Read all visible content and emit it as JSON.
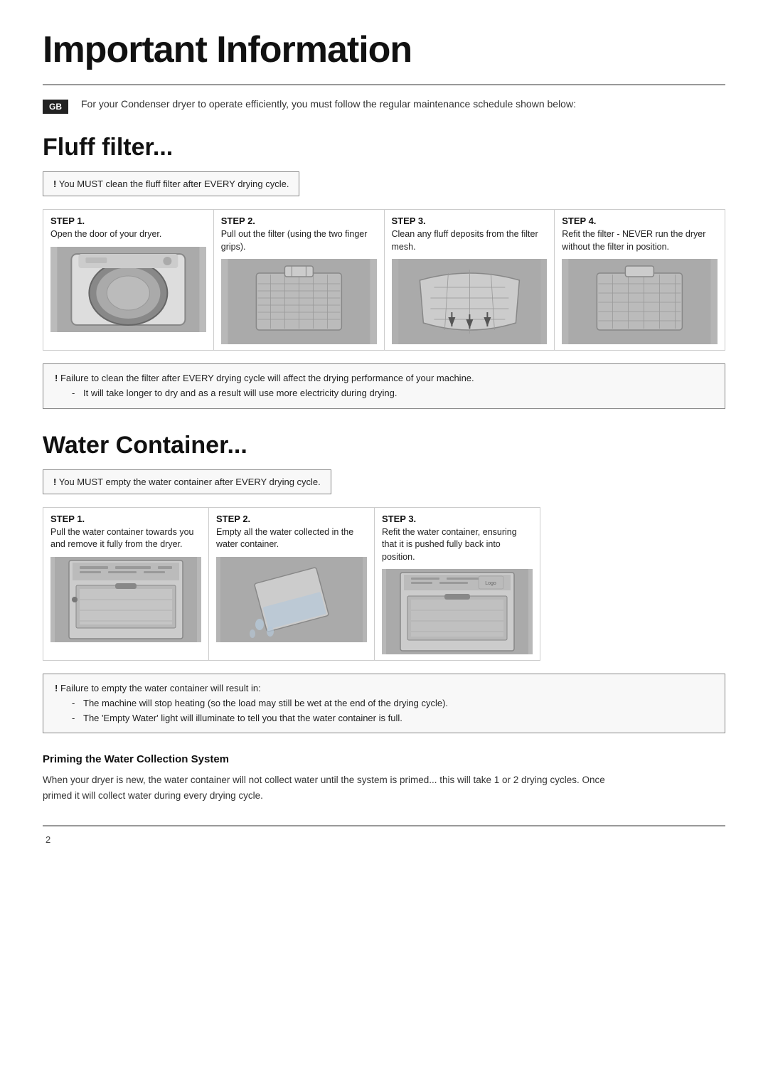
{
  "page": {
    "title": "Important Information",
    "page_number": "2",
    "intro": {
      "gb_label": "GB",
      "text": "For your Condenser dryer to operate efficiently, you must follow the regular maintenance schedule shown below:"
    },
    "fluff_filter": {
      "section_title": "Fluff filter...",
      "notice": {
        "exclaim": "!",
        "text": "You MUST clean the fluff filter after EVERY drying cycle."
      },
      "steps": [
        {
          "label": "STEP 1.",
          "desc": "Open the door of your dryer.",
          "img_alt": "dryer door open"
        },
        {
          "label": "STEP 2.",
          "desc": "Pull out the filter (using the two finger grips).",
          "img_alt": "filter pull"
        },
        {
          "label": "STEP 3.",
          "desc": "Clean any fluff deposits from the filter mesh.",
          "img_alt": "filter clean"
        },
        {
          "label": "STEP 4.",
          "desc": "Refit the filter - NEVER run the dryer without the filter in position.",
          "img_alt": "filter refit"
        }
      ],
      "warning": {
        "exclaim": "!",
        "line1": "Failure to clean the filter after EVERY drying cycle will affect the drying performance of your machine.",
        "list": [
          "It will take longer to dry and as a result will use more electricity during drying."
        ]
      }
    },
    "water_container": {
      "section_title": "Water Container...",
      "notice": {
        "exclaim": "!",
        "text": "You MUST empty the water container after EVERY drying cycle."
      },
      "steps": [
        {
          "label": "STEP 1.",
          "desc": "Pull the water container towards you and remove it fully from the dryer.",
          "img_alt": "water container pull"
        },
        {
          "label": "STEP 2.",
          "desc": "Empty all the water collected in the water container.",
          "img_alt": "water container empty"
        },
        {
          "label": "STEP 3.",
          "desc": "Refit the water container, ensuring that it is pushed fully back into position.",
          "img_alt": "water container refit"
        }
      ],
      "warning": {
        "exclaim": "!",
        "line1": "Failure to empty the water container will result in:",
        "list": [
          "The machine will stop heating (so the load may still be wet at the end of the drying cycle).",
          "The 'Empty Water' light will illuminate to tell you that the water container is full."
        ]
      },
      "priming": {
        "title": "Priming the Water Collection System",
        "text": "When your dryer is new, the water container will not collect water until the system is primed... this will take 1 or 2 drying cycles. Once primed it will collect water during every drying cycle."
      }
    }
  }
}
